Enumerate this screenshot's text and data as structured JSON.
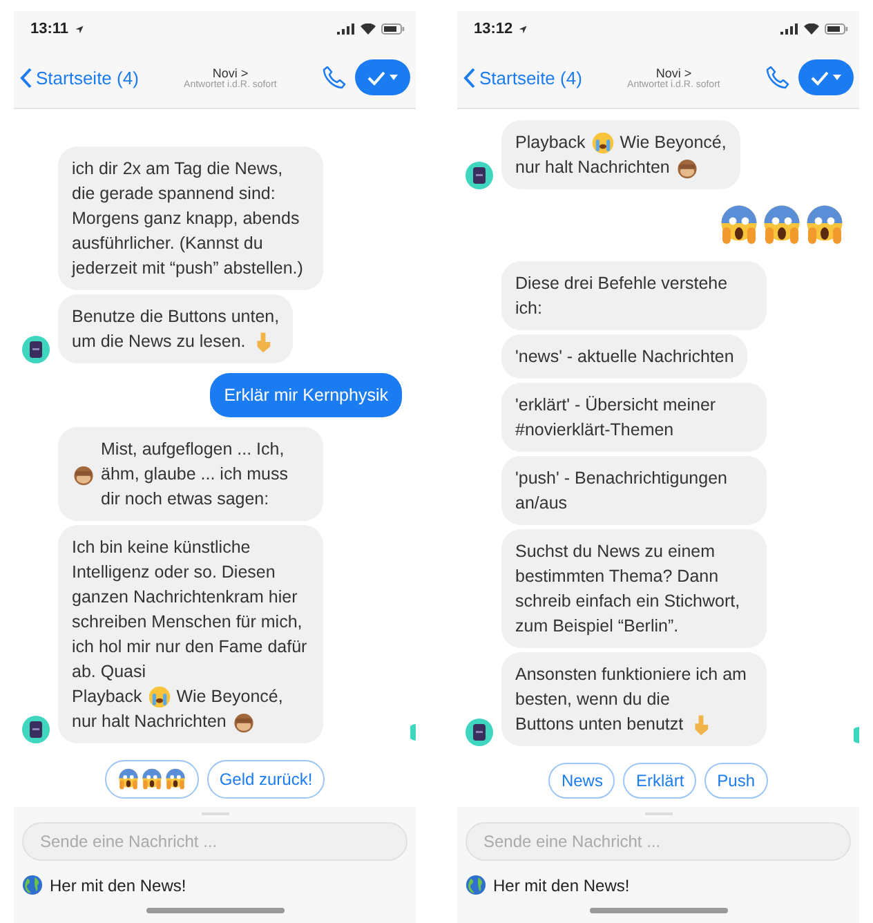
{
  "phones": [
    {
      "status": {
        "time": "13:11"
      },
      "nav": {
        "back": "Startseite (4)",
        "name": "Novi >",
        "subtitle": "Antwortet i.d.R. sofort"
      },
      "messages": [
        {
          "kind": "bot",
          "avatar": false,
          "lines": [
            [
              {
                "kind": "text",
                "text": "ich dir 2x am Tag die News, die gerade spannend sind: Morgens ganz knapp, abends ausführlicher. (Kannst du jederzeit mit “push” abstellen.)"
              }
            ]
          ]
        },
        {
          "kind": "bot",
          "avatar": true,
          "lines": [
            [
              {
                "kind": "text",
                "text": "Benutze die Buttons unten,"
              }
            ],
            [
              {
                "kind": "text",
                "text": "um die News zu lesen."
              },
              {
                "kind": "point-down"
              }
            ]
          ]
        },
        {
          "kind": "user",
          "lines": [
            [
              {
                "kind": "text",
                "text": "Erklär mir Kernphysik"
              }
            ]
          ]
        },
        {
          "kind": "bot",
          "avatar": false,
          "lines": [
            [
              {
                "kind": "monkey"
              },
              {
                "kind": "text",
                "text": "Mist, aufgeflogen ... Ich, ähm, glaube ... ich muss dir noch etwas sagen:"
              }
            ]
          ]
        },
        {
          "kind": "bot",
          "avatar": true,
          "lines": [
            [
              {
                "kind": "text",
                "text": "Ich bin keine künstliche Intelligenz oder so. Diesen ganzen Nachrichtenkram hier schreiben Menschen für mich, ich hol mir nur den Fame dafür ab. Quasi"
              }
            ],
            [
              {
                "kind": "text",
                "text": "Playback"
              },
              {
                "kind": "crying"
              },
              {
                "kind": "text",
                "text": "Wie Beyoncé,"
              }
            ],
            [
              {
                "kind": "text",
                "text": "nur halt Nachrichten"
              },
              {
                "kind": "monkey"
              }
            ]
          ]
        }
      ],
      "quick_replies": [
        {
          "kind": "emojis",
          "emojis": [
            {
              "kind": "scream"
            },
            {
              "kind": "scream"
            },
            {
              "kind": "scream"
            }
          ]
        },
        {
          "kind": "label",
          "label": "Geld zurück!"
        }
      ],
      "composer": {
        "placeholder": "Sende eine Nachricht ...",
        "suggestion": "Her mit den News!"
      }
    },
    {
      "status": {
        "time": "13:12"
      },
      "nav": {
        "back": "Startseite (4)",
        "name": "Novi >",
        "subtitle": "Antwortet i.d.R. sofort"
      },
      "messages": [
        {
          "kind": "bot",
          "avatar": true,
          "lines": [
            [
              {
                "kind": "text",
                "text": "Playback"
              },
              {
                "kind": "crying"
              },
              {
                "kind": "text",
                "text": "Wie Beyoncé,"
              }
            ],
            [
              {
                "kind": "text",
                "text": "nur halt Nachrichten"
              },
              {
                "kind": "monkey"
              }
            ]
          ]
        },
        {
          "kind": "user-emoji",
          "lines": [
            [
              {
                "kind": "scream"
              },
              {
                "kind": "scream"
              },
              {
                "kind": "scream"
              }
            ]
          ]
        },
        {
          "kind": "bot",
          "avatar": false,
          "lines": [
            [
              {
                "kind": "text",
                "text": "Diese drei Befehle verstehe ich:"
              }
            ]
          ]
        },
        {
          "kind": "bot",
          "avatar": false,
          "lines": [
            [
              {
                "kind": "text",
                "text": "'news' - aktuelle Nachrichten"
              }
            ]
          ]
        },
        {
          "kind": "bot",
          "avatar": false,
          "lines": [
            [
              {
                "kind": "text",
                "text": "'erklärt' - Übersicht meiner #novierklärt-Themen"
              }
            ]
          ]
        },
        {
          "kind": "bot",
          "avatar": false,
          "lines": [
            [
              {
                "kind": "text",
                "text": "'push' - Benachrichtigungen an/aus"
              }
            ]
          ]
        },
        {
          "kind": "bot",
          "avatar": false,
          "lines": [
            [
              {
                "kind": "text",
                "text": "Suchst du News zu einem bestimmten Thema? Dann schreib einfach ein Stichwort, zum Beispiel “Berlin”."
              }
            ]
          ]
        },
        {
          "kind": "bot",
          "avatar": true,
          "lines": [
            [
              {
                "kind": "text",
                "text": "Ansonsten funktioniere ich am besten, wenn du die"
              }
            ],
            [
              {
                "kind": "text",
                "text": "Buttons unten benutzt"
              },
              {
                "kind": "point-down"
              }
            ]
          ]
        }
      ],
      "quick_replies": [
        {
          "kind": "label",
          "label": "News"
        },
        {
          "kind": "label",
          "label": "Erklärt"
        },
        {
          "kind": "label",
          "label": "Push"
        }
      ],
      "composer": {
        "placeholder": "Sende eine Nachricht ...",
        "suggestion": "Her mit den News!"
      }
    }
  ]
}
